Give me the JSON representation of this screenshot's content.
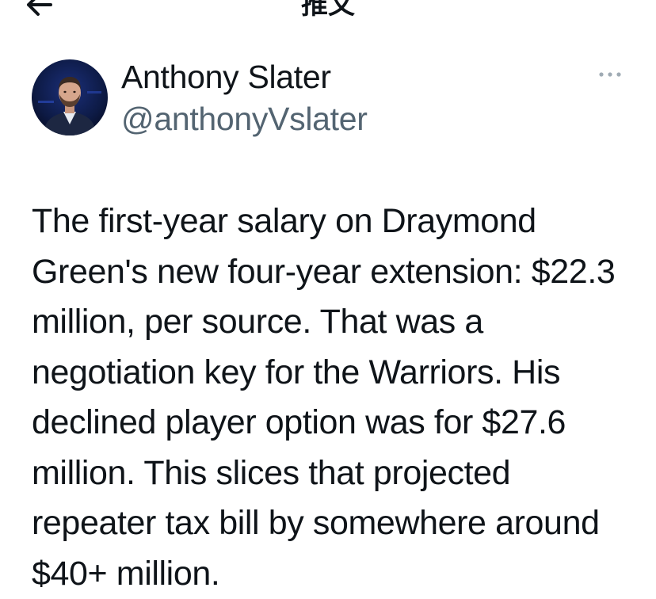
{
  "header": {
    "title": "推文",
    "back_icon": "arrow-left-icon"
  },
  "author": {
    "name": "Anthony Slater",
    "handle": "@anthonyVslater",
    "avatar_icon": "user-avatar"
  },
  "menu": {
    "more_icon": "more-horizontal-icon"
  },
  "tweet": {
    "text": "The first-year salary on Draymond Green's new four-year extension: $22.3 million, per source. That was a negotiation key for the Warriors. His declined player option was for $27.6 million. This slices that projected repeater tax bill by somewhere around $40+ million."
  },
  "colors": {
    "text_primary": "#0f1419",
    "text_secondary": "#536471",
    "more_dots": "#a0abb4",
    "avatar_bg": "#0d1a44"
  }
}
